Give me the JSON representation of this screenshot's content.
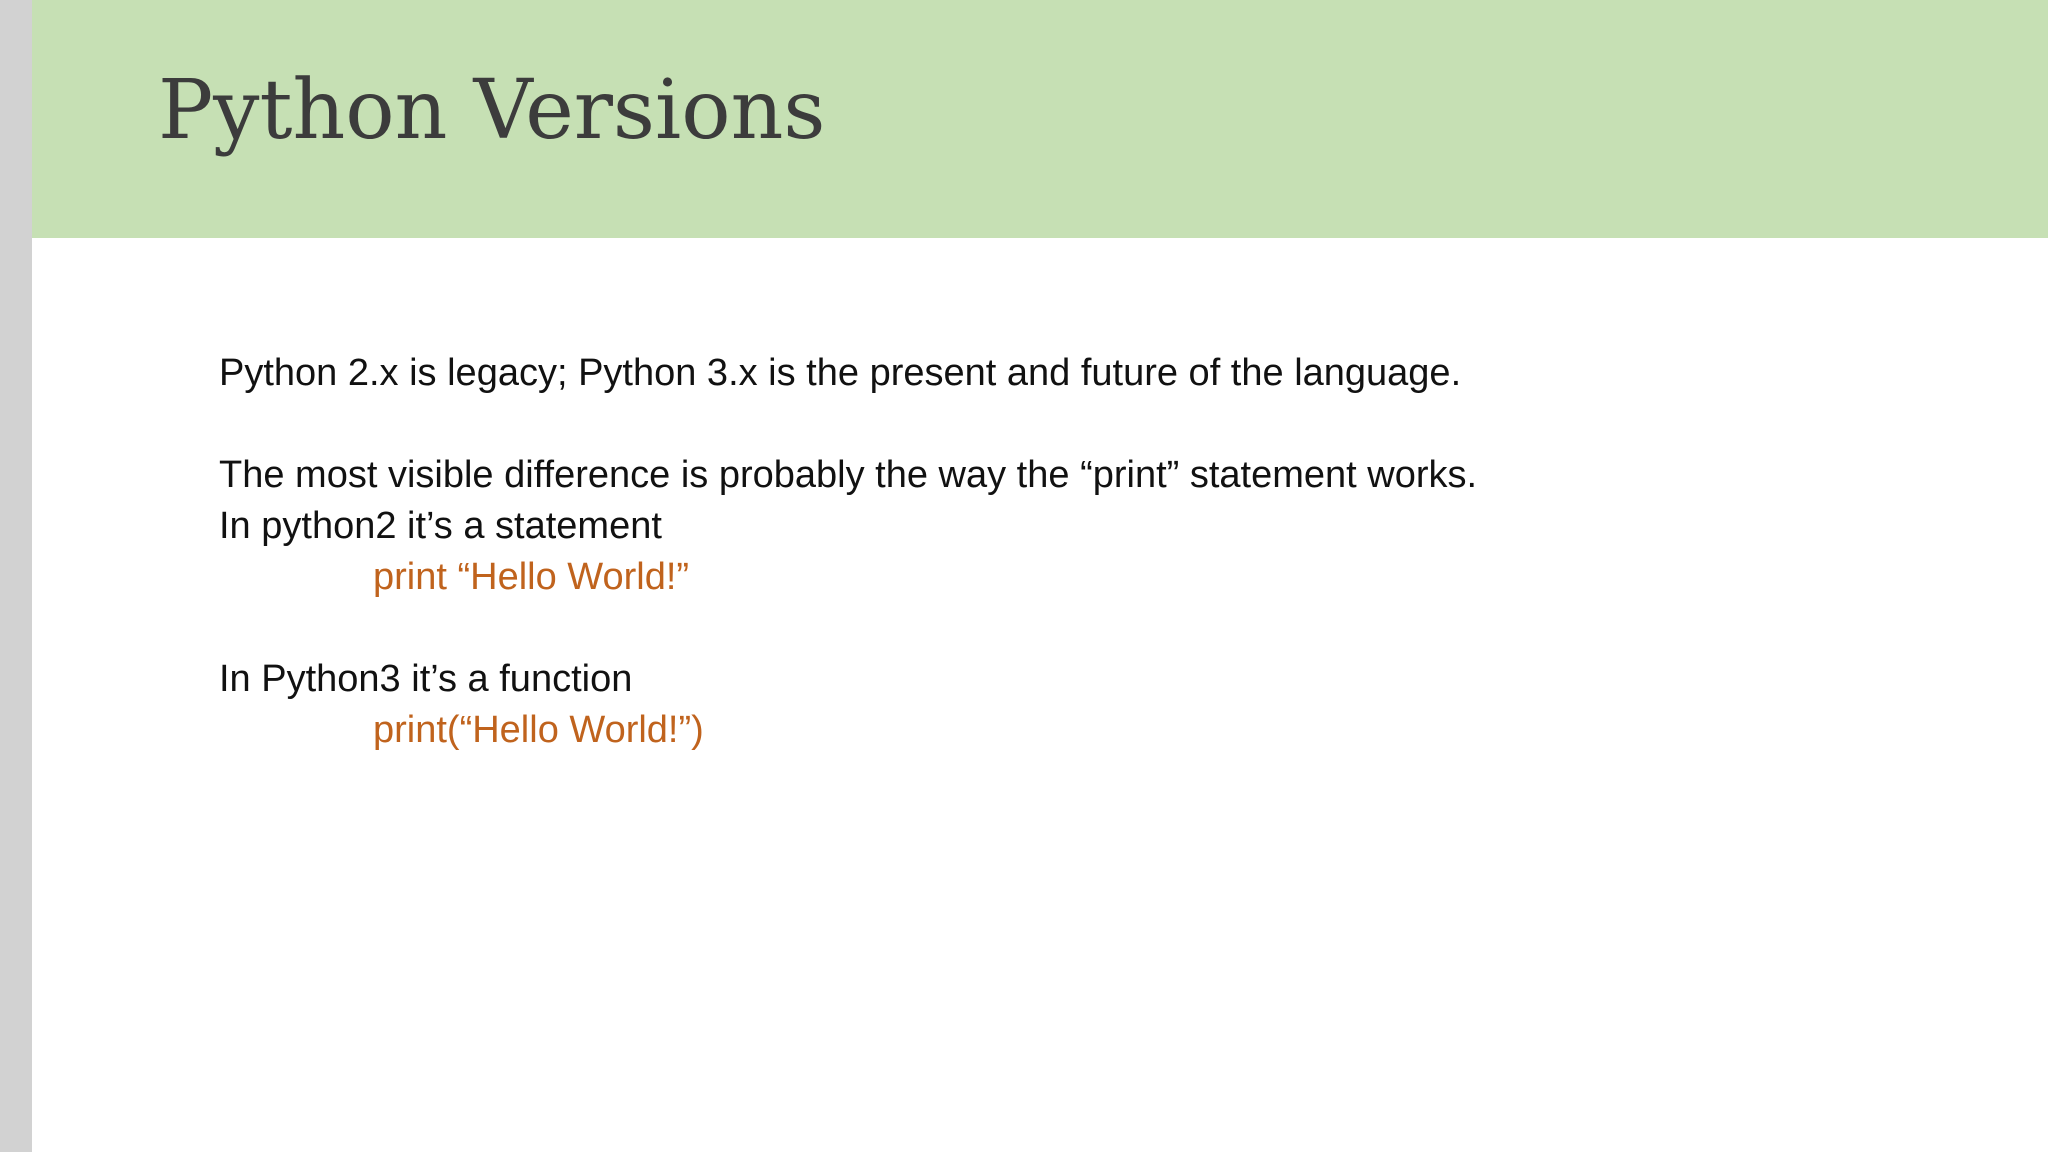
{
  "slide": {
    "title": "Python Versions",
    "lines": [
      "Python 2.x is legacy; Python 3.x is the present and future of the language.",
      "The most visible difference is probably the way the “print” statement works.",
      "In python2 it’s a statement",
      "print “Hello World!”",
      "In Python3 it’s a function",
      "print(“Hello World!”)"
    ]
  },
  "colors": {
    "title_bar": "#c6e0b4",
    "code_text": "#c0631d",
    "body_text": "#111111"
  }
}
